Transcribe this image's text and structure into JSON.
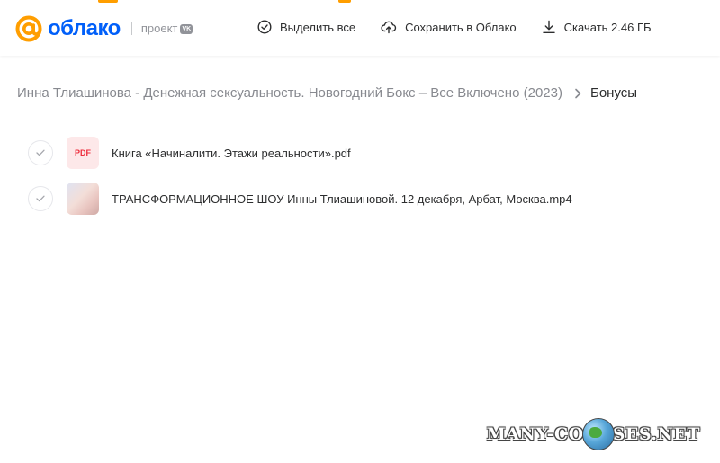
{
  "brand": {
    "name": "облако",
    "project_label": "проект",
    "vk_badge": "VK",
    "accent_color": "#ff9e00",
    "logo_color": "#005ff9"
  },
  "toolbar": {
    "select_all": "Выделить все",
    "save_to_cloud": "Сохранить в Облако",
    "download": "Скачать 2.46 ГБ"
  },
  "breadcrumb": {
    "parent": "Инна Тлиашинова - Денежная сексуальность. Новогодний Бокс – Все Включено (2023)",
    "current": "Бонусы"
  },
  "files": [
    {
      "name": "Книга «Начиналити. Этажи реальности».pdf",
      "type": "pdf",
      "badge": "PDF"
    },
    {
      "name": "ТРАНСФОРМАЦИОННОЕ ШОУ Инны Тлиашиновой. 12 декабря, Арбат, Москва.mp4",
      "type": "video"
    }
  ],
  "watermark": {
    "left": "MANY-CO",
    "right": "SES.NET"
  }
}
